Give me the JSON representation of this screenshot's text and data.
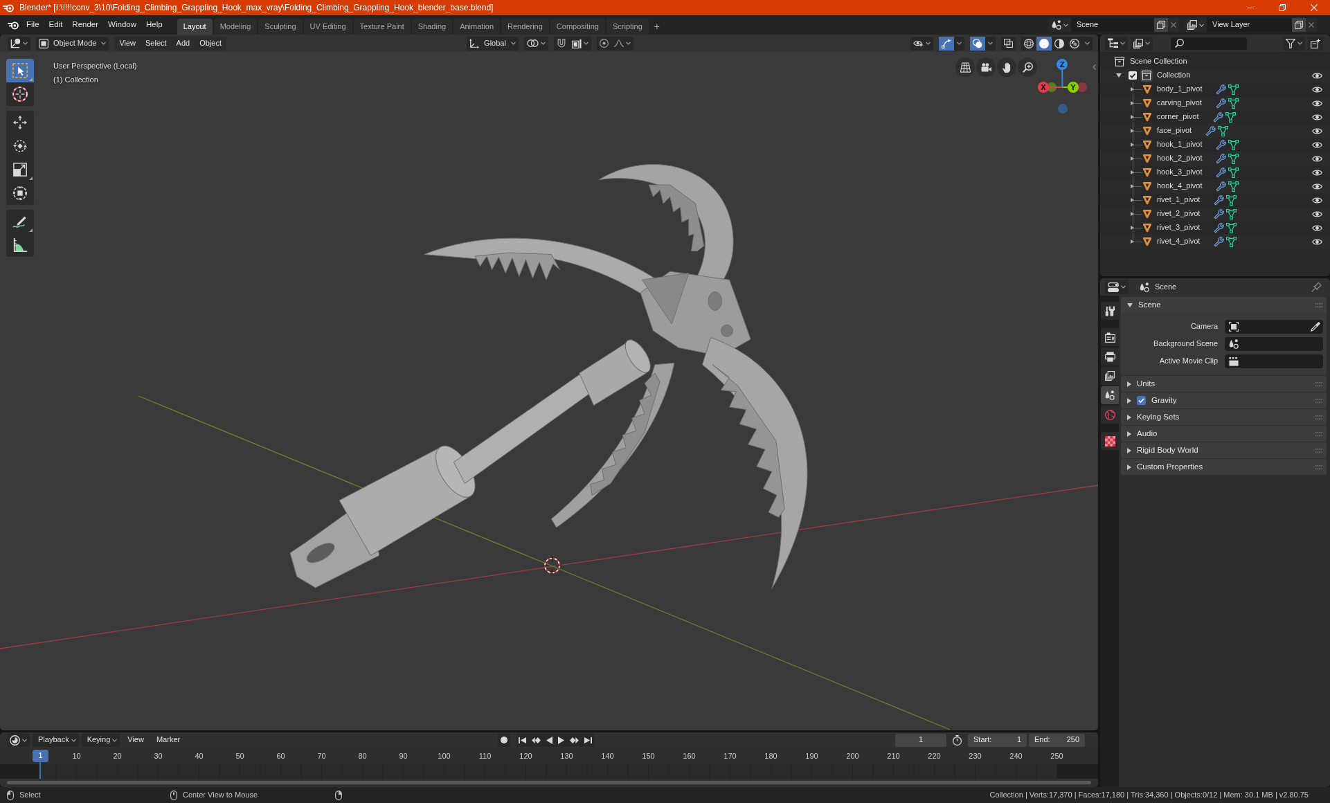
{
  "window": {
    "title": "Blender* [I:\\!!!!conv_3\\10\\Folding_Climbing_Grappling_Hook_max_vray\\Folding_Climbing_Grappling_Hook_blender_base.blend]"
  },
  "top_bar": {
    "menu": [
      "File",
      "Edit",
      "Render",
      "Window",
      "Help"
    ],
    "workspaces": [
      {
        "label": "Layout",
        "selected": true
      },
      {
        "label": "Modeling",
        "selected": false
      },
      {
        "label": "Sculpting",
        "selected": false
      },
      {
        "label": "UV Editing",
        "selected": false
      },
      {
        "label": "Texture Paint",
        "selected": false
      },
      {
        "label": "Shading",
        "selected": false
      },
      {
        "label": "Animation",
        "selected": false
      },
      {
        "label": "Rendering",
        "selected": false
      },
      {
        "label": "Compositing",
        "selected": false
      },
      {
        "label": "Scripting",
        "selected": false
      }
    ],
    "add_workspace": "+",
    "scene": "Scene",
    "view_layer": "View Layer"
  },
  "viewport": {
    "header": {
      "mode": "Object Mode",
      "menu": [
        "View",
        "Select",
        "Add",
        "Object"
      ],
      "orientation": "Global",
      "snap": {
        "on": false
      },
      "proportional": {
        "on": false
      },
      "toggles": [
        {
          "kind": "gizmos",
          "on": true
        },
        {
          "kind": "overlays",
          "on": true
        },
        {
          "kind": "xray",
          "on": false
        }
      ],
      "shading": [
        {
          "kind": "wireframe",
          "selected": false
        },
        {
          "kind": "solid",
          "selected": true
        },
        {
          "kind": "material",
          "selected": false
        },
        {
          "kind": "rendered",
          "selected": false
        }
      ]
    },
    "info": [
      "User Perspective (Local)",
      "(1) Collection"
    ],
    "tool_groups": [
      [
        {
          "kind": "select_box",
          "selected": true,
          "variants": true
        },
        {
          "kind": "cursor",
          "selected": false,
          "variants": false
        }
      ],
      [
        {
          "kind": "move",
          "selected": false,
          "variants": false
        },
        {
          "kind": "rotate",
          "selected": false,
          "variants": false
        },
        {
          "kind": "scale",
          "selected": false,
          "variants": true
        },
        {
          "kind": "transform",
          "selected": false,
          "variants": false
        }
      ],
      [
        {
          "kind": "annotate",
          "selected": false,
          "variants": true
        },
        {
          "kind": "measure",
          "selected": false,
          "variants": false
        }
      ]
    ],
    "gizmo_axes": [
      {
        "label": "X",
        "color": "#e8384f"
      },
      {
        "label": "Y",
        "color": "#88d000"
      },
      {
        "label": "Z",
        "color": "#2d8ae6"
      }
    ]
  },
  "outliner": {
    "root": "Scene Collection",
    "collections": [
      {
        "label": "Collection",
        "checked": true,
        "expanded": true,
        "visible": true,
        "children": [
          {
            "label": "body_1_pivot",
            "expanded": false,
            "visible": true
          },
          {
            "label": "carving_pivot",
            "expanded": false,
            "visible": true
          },
          {
            "label": "corner_pivot",
            "expanded": false,
            "visible": true
          },
          {
            "label": "face_pivot",
            "expanded": false,
            "visible": true
          },
          {
            "label": "hook_1_pivot",
            "expanded": false,
            "visible": true
          },
          {
            "label": "hook_2_pivot",
            "expanded": false,
            "visible": true
          },
          {
            "label": "hook_3_pivot",
            "expanded": false,
            "visible": true
          },
          {
            "label": "hook_4_pivot",
            "expanded": false,
            "visible": true
          },
          {
            "label": "rivet_1_pivot",
            "expanded": false,
            "visible": true
          },
          {
            "label": "rivet_2_pivot",
            "expanded": false,
            "visible": true
          },
          {
            "label": "rivet_3_pivot",
            "expanded": false,
            "visible": true
          },
          {
            "label": "rivet_4_pivot",
            "expanded": false,
            "visible": true
          }
        ]
      }
    ]
  },
  "properties": {
    "context": "Scene",
    "tab_groups": [
      [
        {
          "kind": "tool",
          "selected": false
        }
      ],
      [
        {
          "kind": "render",
          "selected": false
        },
        {
          "kind": "output",
          "selected": false
        },
        {
          "kind": "view_layer",
          "selected": false
        },
        {
          "kind": "scene",
          "selected": true
        },
        {
          "kind": "world",
          "selected": false
        }
      ],
      [
        {
          "kind": "texture",
          "selected": false
        }
      ]
    ],
    "panels": [
      {
        "kind": "plain",
        "title": "Scene",
        "expanded": true,
        "fields": [
          {
            "kind": "camera",
            "label": "Camera"
          },
          {
            "kind": "scene",
            "label": "Background Scene"
          },
          {
            "kind": "clip",
            "label": "Active Movie Clip"
          }
        ]
      },
      {
        "kind": "plain",
        "title": "Units",
        "expanded": false
      },
      {
        "kind": "toggle",
        "title": "Gravity",
        "expanded": false,
        "checked": true
      },
      {
        "kind": "plain",
        "title": "Keying Sets",
        "expanded": false
      },
      {
        "kind": "plain",
        "title": "Audio",
        "expanded": false
      },
      {
        "kind": "plain",
        "title": "Rigid Body World",
        "expanded": false
      },
      {
        "kind": "plain",
        "title": "Custom Properties",
        "expanded": false
      }
    ]
  },
  "timeline": {
    "menu": [
      {
        "kind": "dropdown",
        "label": "Playback"
      },
      {
        "kind": "dropdown",
        "label": "Keying"
      },
      {
        "kind": "menu",
        "label": "View"
      },
      {
        "kind": "menu",
        "label": "Marker"
      }
    ],
    "current_frame": "1",
    "start_label": "Start:",
    "start": "1",
    "end_label": "End:",
    "end": "250",
    "playhead": "1",
    "ruler": [
      "10",
      "20",
      "30",
      "40",
      "50",
      "60",
      "70",
      "80",
      "90",
      "100",
      "110",
      "120",
      "130",
      "140",
      "150",
      "160",
      "170",
      "180",
      "190",
      "200",
      "210",
      "220",
      "230",
      "240",
      "250"
    ]
  },
  "status_bar": {
    "hints": [
      {
        "kind": "left",
        "label": "Select"
      },
      {
        "kind": "middle",
        "label": "Center View to Mouse"
      },
      {
        "kind": "right"
      }
    ],
    "stats": "Collection | Verts:17,370 | Faces:17,180 | Tris:34,360 | Objects:0/12 | Mem: 30.1 MB | v2.80.75"
  }
}
